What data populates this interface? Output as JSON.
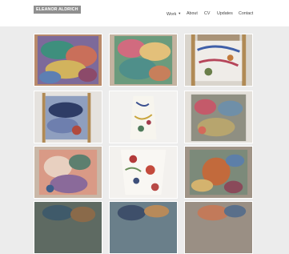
{
  "site": {
    "name": "ELEANOR ALDRICH"
  },
  "nav": {
    "items": [
      {
        "label": "Work",
        "has_dropdown": true
      },
      {
        "label": "About"
      },
      {
        "label": "CV"
      },
      {
        "label": "Updates"
      },
      {
        "label": "Contact"
      }
    ]
  },
  "colors": {
    "page_bg": "#ececec",
    "header_bg": "#ffffff",
    "logo_bg": "#8f8f8f",
    "nav_text": "#444444"
  },
  "gallery": {
    "thumbnails": [
      {
        "icon": "painting-thumbnail"
      },
      {
        "icon": "painting-thumbnail"
      },
      {
        "icon": "painting-thumbnail"
      },
      {
        "icon": "painting-thumbnail"
      },
      {
        "icon": "painting-thumbnail"
      },
      {
        "icon": "painting-thumbnail"
      },
      {
        "icon": "painting-thumbnail"
      },
      {
        "icon": "painting-thumbnail"
      },
      {
        "icon": "painting-thumbnail"
      },
      {
        "icon": "painting-thumbnail"
      },
      {
        "icon": "painting-thumbnail"
      },
      {
        "icon": "painting-thumbnail"
      }
    ]
  }
}
